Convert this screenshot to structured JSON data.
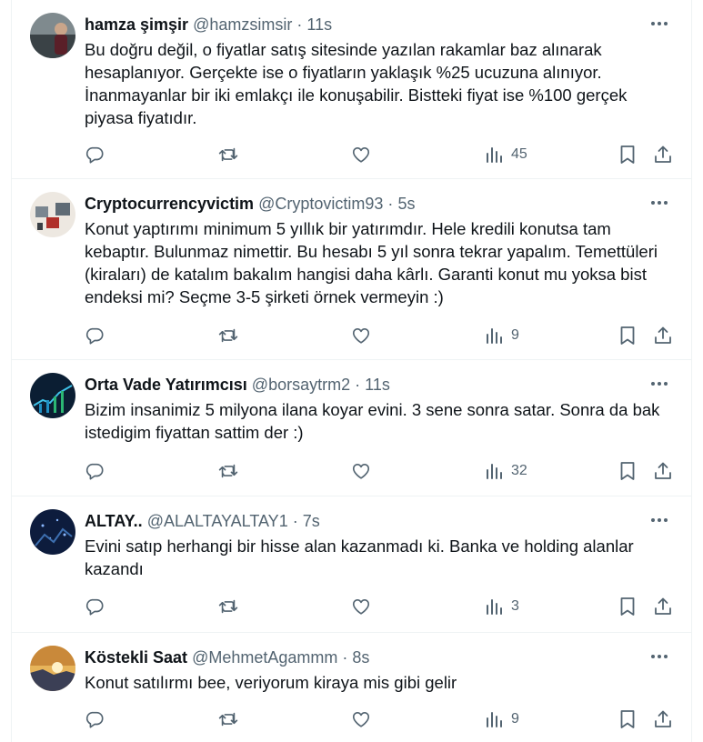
{
  "tweets": [
    {
      "name": "hamza şimşir",
      "handle": "@hamzsimsir",
      "sep": "·",
      "time": "11s",
      "text": "Bu doğru değil, o fiyatlar satış sitesinde yazılan rakamlar baz alınarak hesaplanıyor. Gerçekte ise o fiyatların yaklaşık %25 ucuzuna alınıyor. İnanmayanlar bir iki emlakçı ile konuşabilir. Bistteki fiyat ise %100 gerçek piyasa fiyatıdır.",
      "views": "45",
      "avatar_colors": [
        "#6e7a80",
        "#2e3438"
      ]
    },
    {
      "name": "Cryptocurrencyvictim",
      "handle": "@Cryptovictim93",
      "sep": "·",
      "time": "5s",
      "text": "Konut yaptırımı minimum 5 yıllık bir yatırımdır. Hele kredili konutsa tam kebaptır. Bulunmaz nimettir. Bu hesabı 5 yıl sonra tekrar yapalım. Temettüleri (kiraları) de katalım bakalım hangisi daha kârlı. Garanti konut mu yoksa bist endeksi mi? Seçme 3-5 şirketi örnek vermeyin :)",
      "views": "9",
      "avatar_colors": [
        "#e9e4de",
        "#b0302a"
      ]
    },
    {
      "name": "Orta Vade Yatırımcısı",
      "handle": "@borsaytrm2",
      "sep": "·",
      "time": "11s",
      "text": "Bizim insanimiz 5 milyona ilana koyar evini. 3 sene sonra satar. Sonra da bak istedigim fiyattan sattim der :)",
      "views": "32",
      "avatar_colors": [
        "#0b1e33",
        "#1f8fc4"
      ]
    },
    {
      "name": "ALTAY..",
      "handle": "@ALALTAYALTAY1",
      "sep": "·",
      "time": "7s",
      "text": "Evini satıp herhangi bir hisse alan kazanmadı ki. Banka ve holding alanlar kazandı",
      "views": "3",
      "avatar_colors": [
        "#0d1c3d",
        "#3d6fb0"
      ]
    },
    {
      "name": "Köstekli Saat",
      "handle": "@MehmetAgammm",
      "sep": "·",
      "time": "8s",
      "text": "Konut satılırmı bee, veriyorum kiraya mis gibi gelir",
      "views": "9",
      "avatar_colors": [
        "#d9a441",
        "#3b3f55"
      ]
    }
  ],
  "colors": {
    "text": "#0f1419",
    "muted": "#536471",
    "border": "#eff3f4"
  }
}
